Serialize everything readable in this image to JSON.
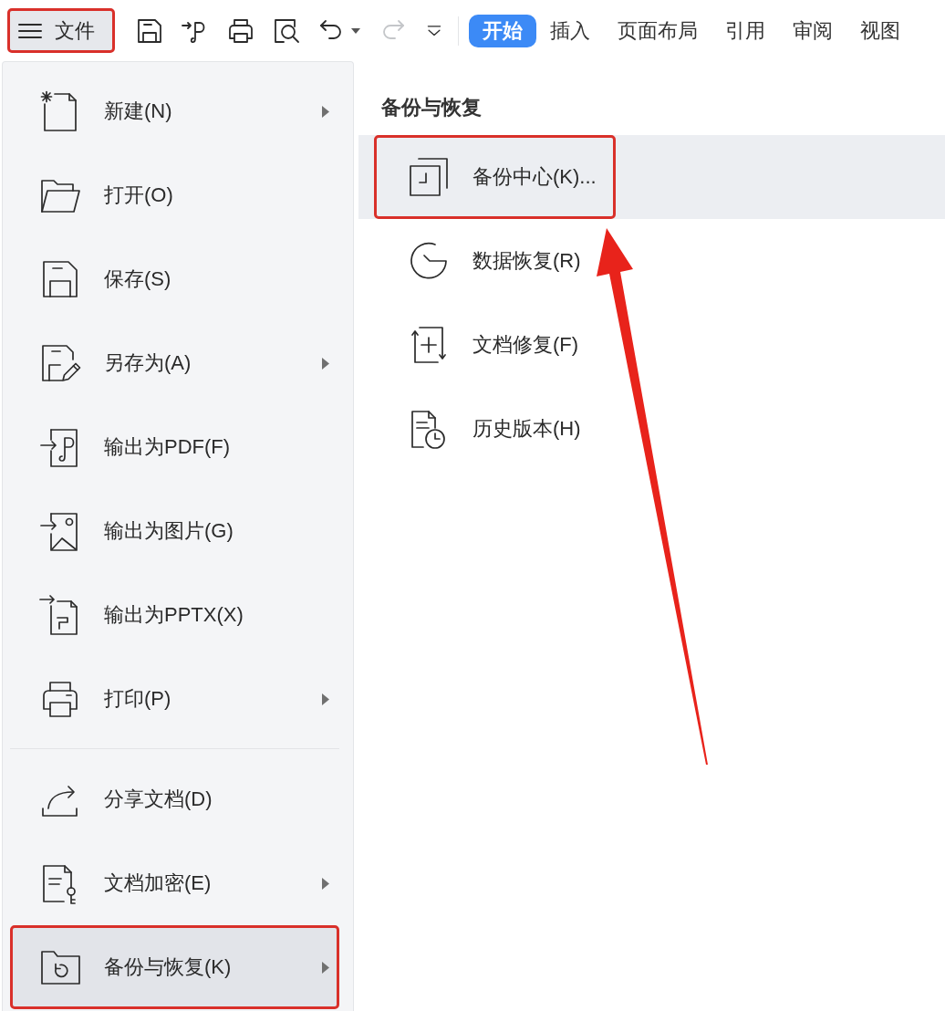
{
  "toolbar": {
    "file_button": {
      "label": "文件",
      "callout": true
    },
    "quick_actions": [
      {
        "disabled": false,
        "dropdown": false
      },
      {
        "disabled": false,
        "dropdown": false
      },
      {
        "disabled": false,
        "dropdown": false
      },
      {
        "disabled": false,
        "dropdown": false
      },
      {
        "disabled": false,
        "dropdown": true
      },
      {
        "disabled": true,
        "dropdown": false
      },
      {
        "disabled": false,
        "dropdown": false
      }
    ],
    "tabs": [
      {
        "label": "开始",
        "selected": true
      },
      {
        "label": "插入",
        "selected": false
      },
      {
        "label": "页面布局",
        "selected": false
      },
      {
        "label": "引用",
        "selected": false
      },
      {
        "label": "审阅",
        "selected": false
      },
      {
        "label": "视图",
        "selected": false
      }
    ]
  },
  "file_menu": {
    "groups": [
      [
        {
          "label": "新建(N)",
          "submenu": true,
          "selected": false,
          "callout": false
        },
        {
          "label": "打开(O)",
          "submenu": false,
          "selected": false,
          "callout": false
        },
        {
          "label": "保存(S)",
          "submenu": false,
          "selected": false,
          "callout": false
        },
        {
          "label": "另存为(A)",
          "submenu": true,
          "selected": false,
          "callout": false
        },
        {
          "label": "输出为PDF(F)",
          "submenu": false,
          "selected": false,
          "callout": false
        },
        {
          "label": "输出为图片(G)",
          "submenu": false,
          "selected": false,
          "callout": false
        },
        {
          "label": "输出为PPTX(X)",
          "submenu": false,
          "selected": false,
          "callout": false
        },
        {
          "label": "打印(P)",
          "submenu": true,
          "selected": false,
          "callout": false
        }
      ],
      [
        {
          "label": "分享文档(D)",
          "submenu": false,
          "selected": false,
          "callout": false
        },
        {
          "label": "文档加密(E)",
          "submenu": true,
          "selected": false,
          "callout": false
        },
        {
          "label": "备份与恢复(K)",
          "submenu": true,
          "selected": true,
          "callout": true
        }
      ]
    ]
  },
  "submenu": {
    "title": "备份与恢复",
    "items": [
      {
        "label": "备份中心(K)...",
        "selected": true,
        "callout": true
      },
      {
        "label": "数据恢复(R)",
        "selected": false,
        "callout": false
      },
      {
        "label": "文档修复(F)",
        "selected": false,
        "callout": false
      },
      {
        "label": "历史版本(H)",
        "selected": false,
        "callout": false
      }
    ]
  },
  "annotations": {
    "arrow": true
  }
}
